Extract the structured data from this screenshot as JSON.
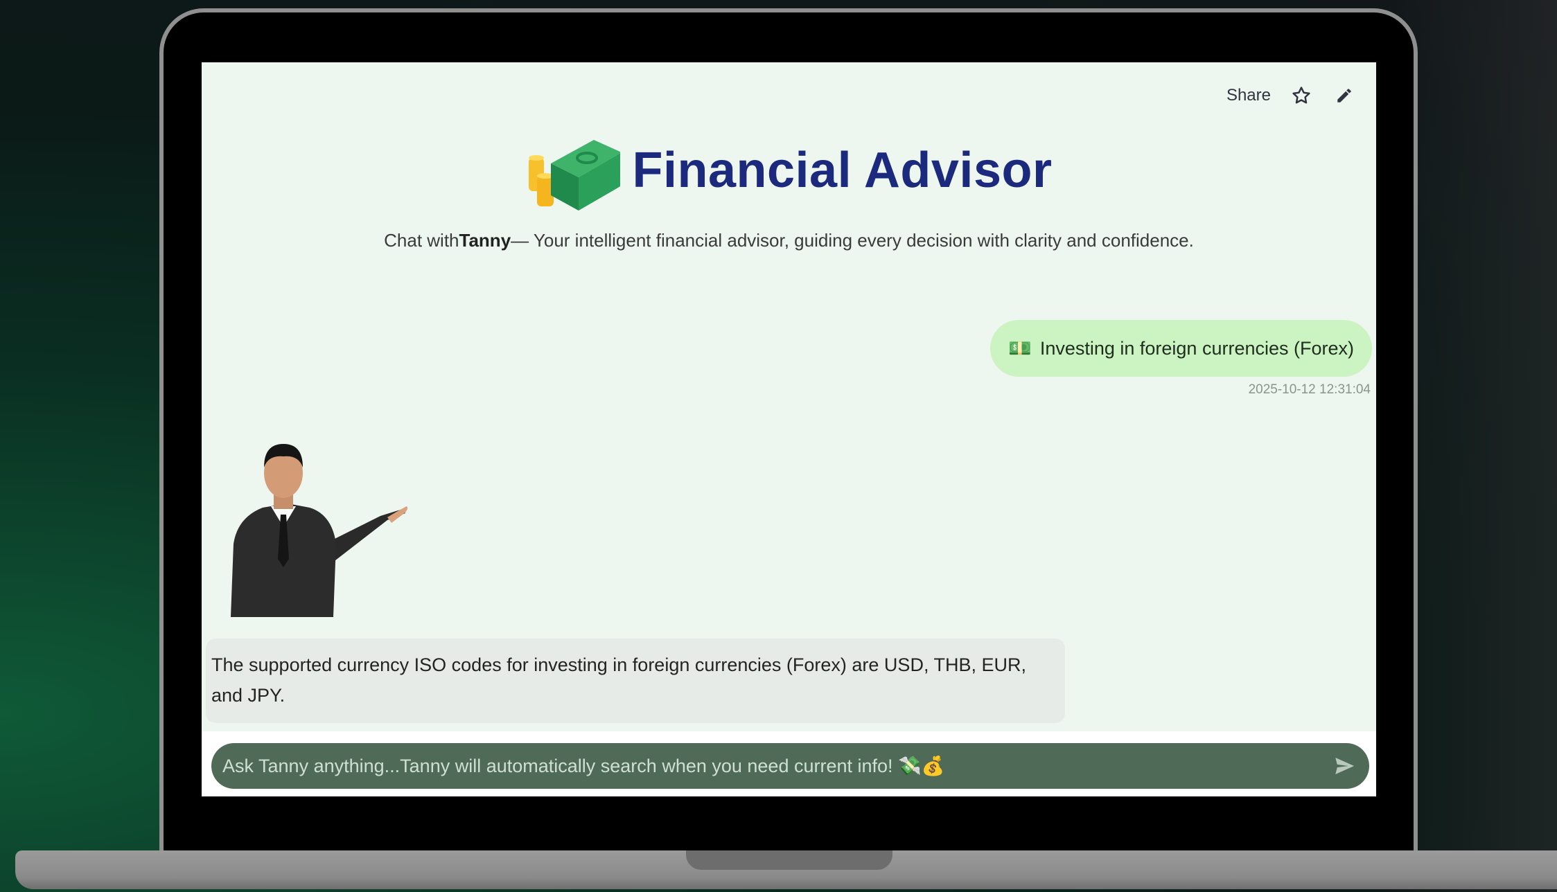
{
  "topbar": {
    "share_label": "Share",
    "star_icon": "star-outline-icon",
    "edit_icon": "pencil-icon"
  },
  "header": {
    "logo_icon": "money-stack-coins-icon",
    "title": "Financial Advisor"
  },
  "subtitle": {
    "prefix": "Chat with",
    "name": "Tanny",
    "suffix": "— Your intelligent financial advisor, guiding every decision with clarity and confidence."
  },
  "messages": {
    "user": {
      "emoji": "💵",
      "text": "Investing in foreign currencies (Forex)",
      "timestamp": "2025-10-12 12:31:04"
    },
    "assistant": {
      "avatar_icon": "businessman-avatar",
      "text": "The supported currency ISO codes for investing in foreign currencies (Forex) are USD, THB, EUR, and JPY."
    }
  },
  "chat_input": {
    "placeholder": "Ask Tanny anything...Tanny will automatically search when you need current info! 💸💰",
    "send_icon": "send-arrow-icon"
  },
  "colors": {
    "screen_bg": "#eef6f0",
    "title": "#1c2a7d",
    "user_bubble": "#ccf3c2",
    "assistant_bubble": "#e7ebe8",
    "input_bg": "#4f6a56"
  }
}
